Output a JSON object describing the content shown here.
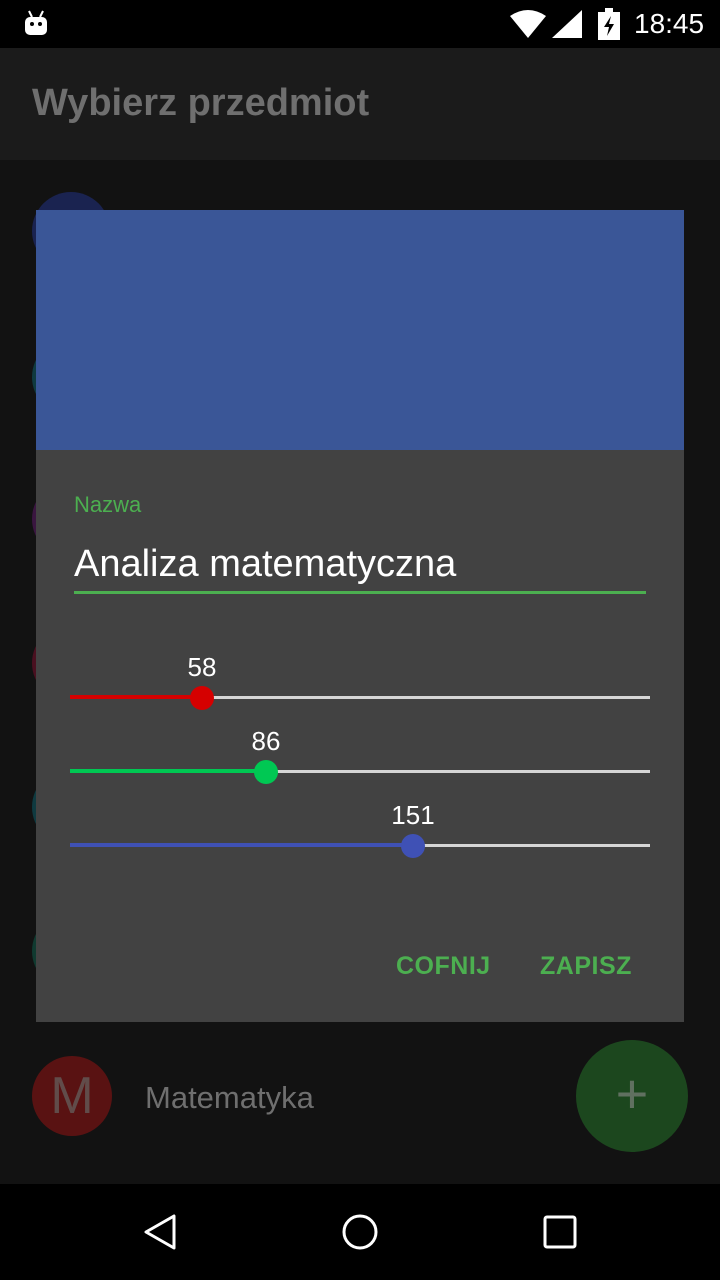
{
  "status_bar": {
    "time": "18:45",
    "icons": [
      "android-icon",
      "wifi-icon",
      "signal-icon",
      "battery-charging-icon"
    ]
  },
  "app": {
    "title": "Wybierz przedmiot",
    "list_items": [
      {
        "initial": "M",
        "label": "Matematyka",
        "avatar_color": "#c62828"
      }
    ],
    "fab_label": "+",
    "fab_color": "#388e3c"
  },
  "dialog": {
    "preview_color": "#3a5697",
    "name_label": "Nazwa",
    "name_value": "Analiza matematyczna",
    "sliders": [
      {
        "name": "red",
        "value": 58,
        "max": 255,
        "color": "#d50000"
      },
      {
        "name": "green",
        "value": 86,
        "max": 255,
        "color": "#00c853"
      },
      {
        "name": "blue",
        "value": 151,
        "max": 255,
        "color": "#3f51b5"
      }
    ],
    "cancel_label": "COFNIJ",
    "save_label": "ZAPISZ"
  },
  "nav_bar": {
    "buttons": [
      "back-icon",
      "home-icon",
      "recents-icon"
    ]
  }
}
